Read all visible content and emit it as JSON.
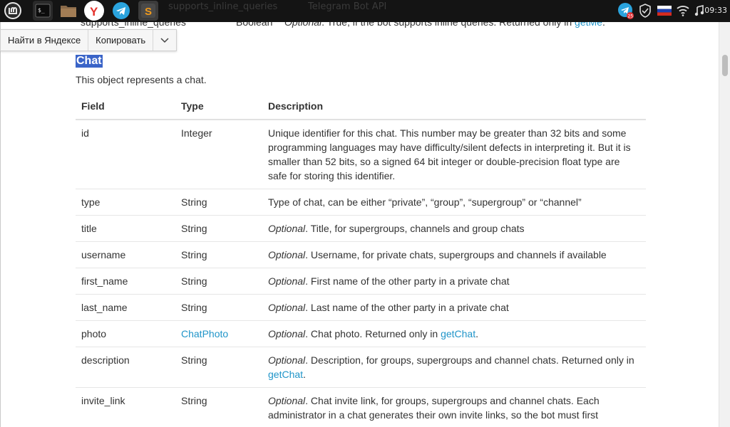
{
  "taskbar": {
    "apps": [
      {
        "name": "mint-menu-icon"
      },
      {
        "name": "terminal-icon"
      },
      {
        "name": "files-icon"
      },
      {
        "name": "yandex-browser-icon"
      },
      {
        "name": "telegram-icon"
      },
      {
        "name": "sublime-text-icon"
      }
    ],
    "ghost_left": "supports_inline_queries",
    "ghost_title": "Telegram Bot API",
    "tray": {
      "telegram_badge": "25",
      "clock": "09:33"
    }
  },
  "popup": {
    "search_label": "Найти в Яндексе",
    "copy_label": "Копировать"
  },
  "prev_row": {
    "field": "supports_inline_queries",
    "type": "Boolean",
    "desc_em": "Optional",
    "desc_text": ". True, if the bot supports inline queries. Returned only in ",
    "desc_link": "getMe",
    "desc_end": "."
  },
  "section": {
    "title": "Chat",
    "intro": "This object represents a chat."
  },
  "table": {
    "headers": {
      "field": "Field",
      "type": "Type",
      "description": "Description"
    },
    "rows": [
      {
        "field": "id",
        "type": "Integer",
        "desc": "Unique identifier for this chat. This number may be greater than 32 bits and some programming languages may have difficulty/silent defects in interpreting it. But it is smaller than 52 bits, so a signed 64 bit integer or double-precision float type are safe for storing this identifier."
      },
      {
        "field": "type",
        "type": "String",
        "desc": "Type of chat, can be either “private”, “group”, “supergroup” or “channel”"
      },
      {
        "field": "title",
        "type": "String",
        "desc_em": "Optional",
        "desc": ". Title, for supergroups, channels and group chats"
      },
      {
        "field": "username",
        "type": "String",
        "desc_em": "Optional",
        "desc": ". Username, for private chats, supergroups and channels if available"
      },
      {
        "field": "first_name",
        "type": "String",
        "desc_em": "Optional",
        "desc": ". First name of the other party in a private chat"
      },
      {
        "field": "last_name",
        "type": "String",
        "desc_em": "Optional",
        "desc": ". Last name of the other party in a private chat"
      },
      {
        "field": "photo",
        "type": "ChatPhoto",
        "desc_em": "Optional",
        "desc": ". Chat photo. Returned only in ",
        "desc_link": "getChat",
        "desc_end": "."
      },
      {
        "field": "description",
        "type": "String",
        "desc_em": "Optional",
        "desc": ". Description, for groups, supergroups and channel chats. Returned only in ",
        "desc_link": "getChat",
        "desc_end": "."
      },
      {
        "field": "invite_link",
        "type": "String",
        "desc_em": "Optional",
        "desc": ". Chat invite link, for groups, supergroups and channel chats. Each administrator in a chat generates their own invite links, so the bot must first"
      }
    ]
  },
  "colors": {
    "link": "#2095c9",
    "selection": "#3a64c8",
    "taskbar": "#141414"
  }
}
